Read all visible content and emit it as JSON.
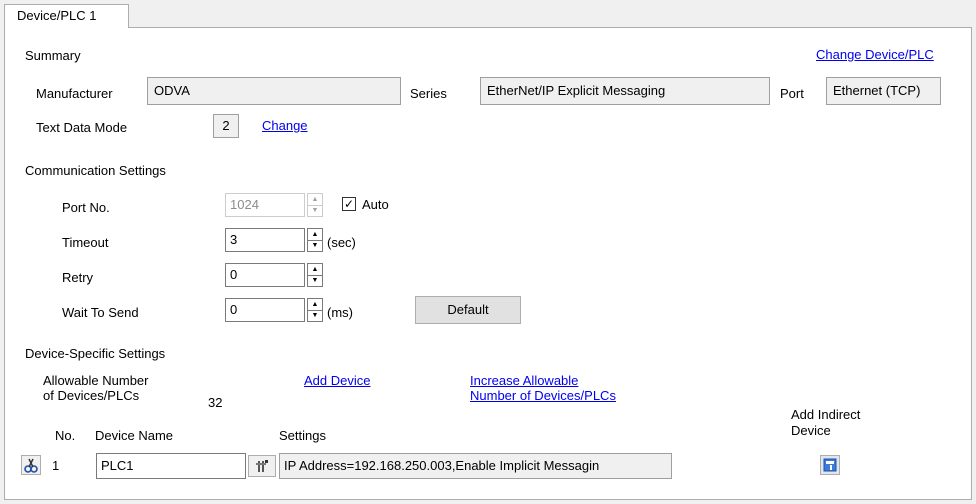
{
  "tab": {
    "label": "Device/PLC 1"
  },
  "summary": {
    "heading": "Summary",
    "change_link": "Change Device/PLC",
    "manufacturer_label": "Manufacturer",
    "manufacturer_value": "ODVA",
    "series_label": "Series",
    "series_value": "EtherNet/IP Explicit Messaging",
    "port_label": "Port",
    "port_value": "Ethernet (TCP)",
    "text_mode_label": "Text Data Mode",
    "text_mode_value": "2",
    "text_mode_change": "Change"
  },
  "comm": {
    "heading": "Communication Settings",
    "port_no_label": "Port No.",
    "port_no_value": "1024",
    "auto_label": "Auto",
    "auto_checked": true,
    "timeout_label": "Timeout",
    "timeout_value": "3",
    "timeout_unit": "(sec)",
    "retry_label": "Retry",
    "retry_value": "0",
    "wait_label": "Wait To Send",
    "wait_value": "0",
    "wait_unit": "(ms)",
    "default_button": "Default"
  },
  "device": {
    "heading": "Device-Specific Settings",
    "allowable_line1": "Allowable Number",
    "allowable_line2": "of Devices/PLCs",
    "allowable_count": "32",
    "add_device_link": "Add Device",
    "increase_line1": "Increase Allowable",
    "increase_line2": "Number of Devices/PLCs",
    "col_no": "No.",
    "col_name": "Device Name",
    "col_settings": "Settings",
    "col_indirect_line1": "Add Indirect",
    "col_indirect_line2": "Device",
    "rows": [
      {
        "no": "1",
        "name": "PLC1",
        "settings": "IP Address=192.168.250.003,Enable Implicit Messagin"
      }
    ]
  },
  "colors": {
    "link": "#0000ee",
    "panel_bg": "#ffffff",
    "window_bg": "#f0f0f0"
  },
  "icons": [
    "delete-device-icon",
    "settings-edit-icon",
    "add-indirect-device-icon",
    "spin-up-icon",
    "spin-down-icon",
    "checkmark-icon"
  ]
}
